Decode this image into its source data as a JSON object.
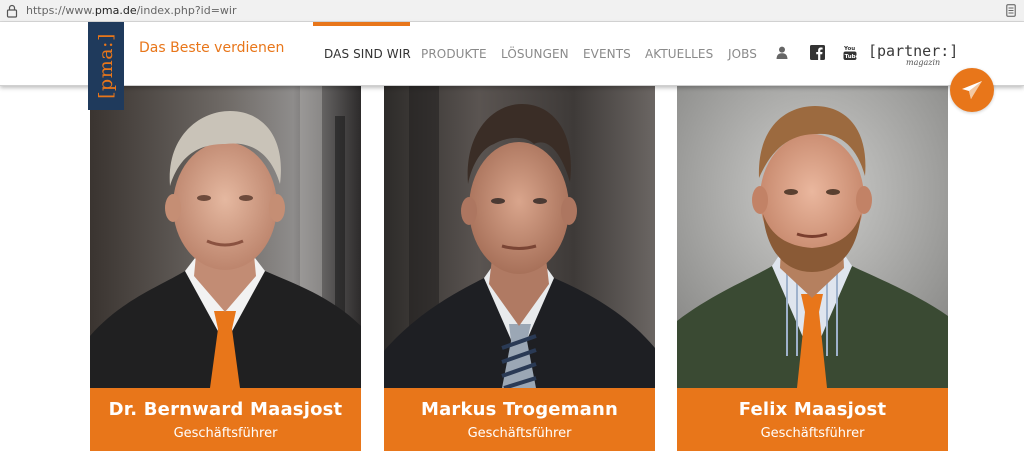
{
  "browser": {
    "url_prefix": "https://www.",
    "url_domain": "pma.de",
    "url_path": "/index.php?id=wir"
  },
  "header": {
    "logo_text": "[pma:]",
    "tagline": "Das Beste verdienen",
    "nav": [
      "DAS SIND WIR",
      "PRODUKTE",
      "LÖSUNGEN",
      "EVENTS",
      "AKTUELLES",
      "JOBS"
    ],
    "active_nav": "DAS SIND WIR",
    "icons": [
      "user-icon",
      "facebook-icon",
      "youtube-icon"
    ],
    "partner_label": "[partner:]",
    "partner_sub": "magazin",
    "accent_color": "#e8761a",
    "logo_bg": "#1f3a5c"
  },
  "team": [
    {
      "name": "Dr. Bernward Maasjost",
      "role": "Geschäftsführer"
    },
    {
      "name": "Markus Trogemann",
      "role": "Geschäftsführer"
    },
    {
      "name": "Felix Maasjost",
      "role": "Geschäftsführer"
    }
  ],
  "floating_button": {
    "icon": "paper-plane-icon"
  }
}
